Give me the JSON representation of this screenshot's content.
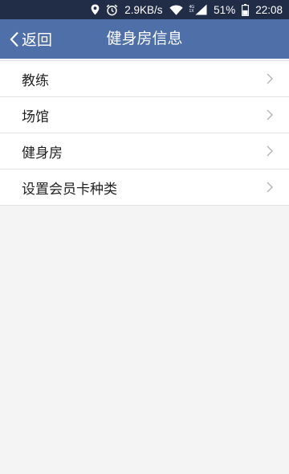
{
  "status_bar": {
    "speed": "2.9KB/s",
    "network_top": "4G",
    "network_bottom": "1X",
    "battery": "51%",
    "time": "22:08",
    "icons": [
      "location-icon",
      "alarm-icon",
      "wifi-icon",
      "signal-icon",
      "battery-icon"
    ],
    "battery_level": 0.51
  },
  "nav": {
    "back_label": "返回",
    "title": "健身房信息",
    "back_icon": "chevron-left-icon"
  },
  "menu": {
    "items": [
      {
        "label": "教练"
      },
      {
        "label": "场馆"
      },
      {
        "label": "健身房"
      },
      {
        "label": "设置会员卡种类"
      }
    ],
    "chevron_icon": "chevron-right-icon"
  },
  "colors": {
    "status_bar_bg": "#212d47",
    "nav_bg": "#4f6fa8",
    "page_bg": "#f4f4f4",
    "divider": "#e3e3e3",
    "chevron": "#b5b5b5"
  }
}
